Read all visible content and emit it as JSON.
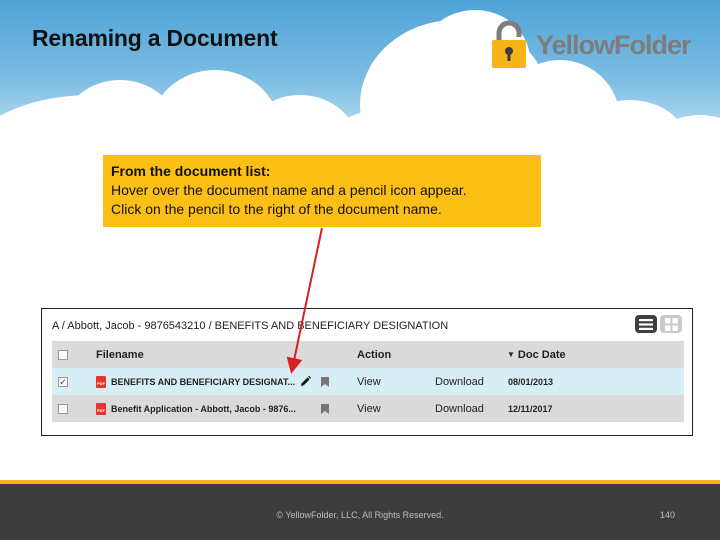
{
  "slide": {
    "title": "Renaming a Document",
    "brand": "YellowFolder"
  },
  "callout": {
    "heading": "From the document list:",
    "line1": "Hover over the document name and a pencil icon appear.",
    "line2": "Click on the pencil to the right of the document name."
  },
  "panel": {
    "breadcrumb": "A / Abbott, Jacob - 9876543210 / BENEFITS AND BENEFICIARY DESIGNATION",
    "columns": {
      "filename": "Filename",
      "action": "Action",
      "doc_date": "Doc Date"
    },
    "rows": [
      {
        "checked": "✓",
        "filename": "BENEFITS AND BENEFICIARY DESIGNAT...",
        "view": "View",
        "download": "Download",
        "date": "08/01/2013",
        "pdf": "PDF"
      },
      {
        "checked": "",
        "filename": "Benefit Application - Abbott, Jacob - 9876...",
        "view": "View",
        "download": "Download",
        "date": "12/11/2017",
        "pdf": "PDF"
      }
    ]
  },
  "footer": {
    "copyright": "© YellowFolder, LLC, All Rights Reserved.",
    "page_number": "140"
  },
  "colors": {
    "accent": "#fbbf16",
    "arrow": "#d9201f",
    "footer": "#3d3d3d"
  }
}
